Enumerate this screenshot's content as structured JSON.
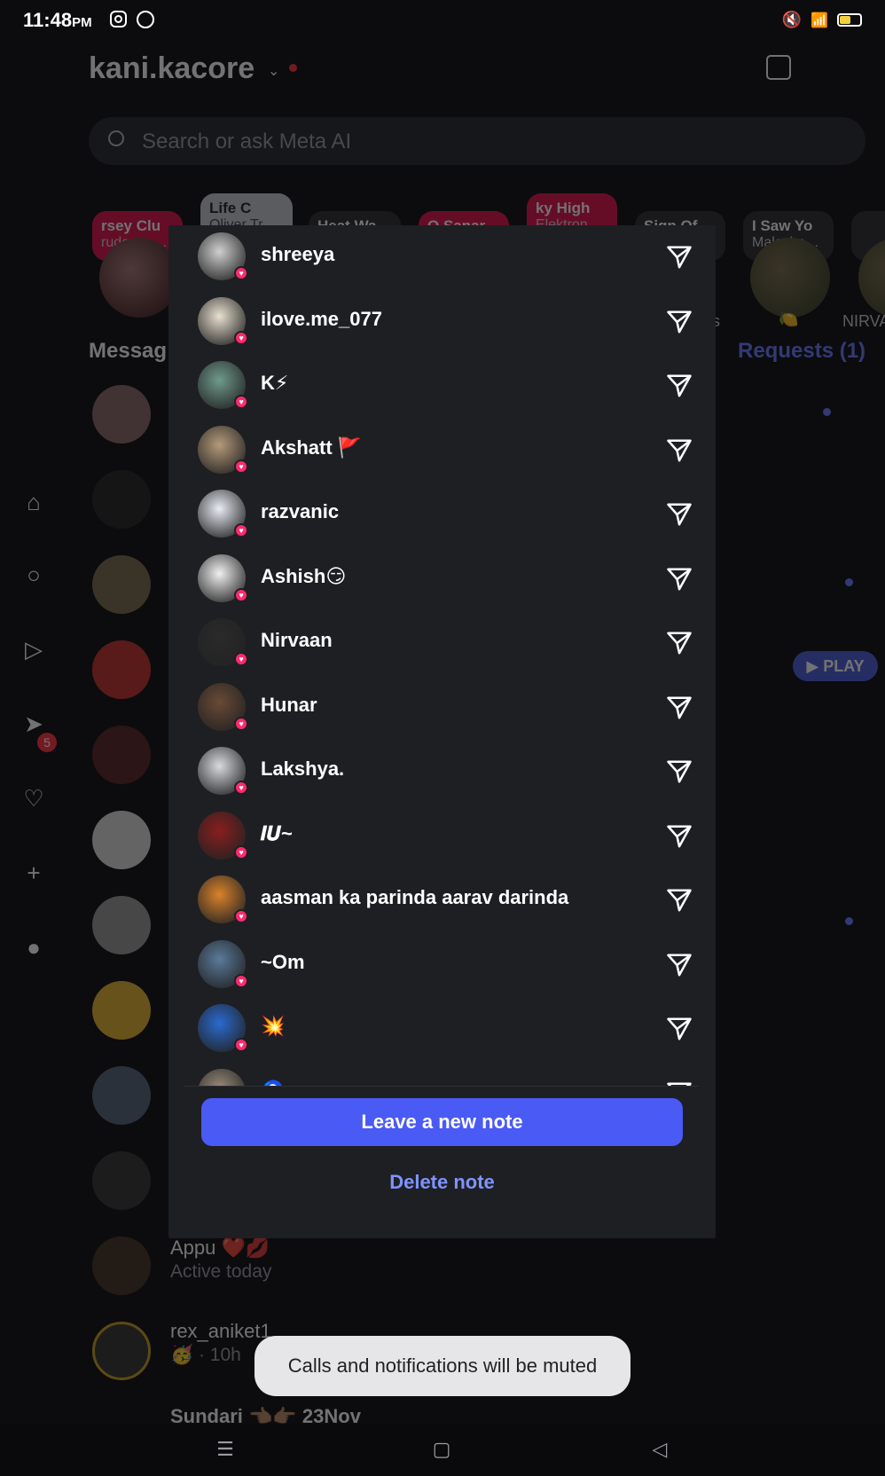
{
  "status_bar": {
    "time": "11:48",
    "ampm": "PM"
  },
  "header": {
    "username": "kani.kacore"
  },
  "search": {
    "placeholder": "Search or ask Meta AI"
  },
  "notes": [
    {
      "title": "rsey Clu",
      "subtitle": "rudo ma…"
    },
    {
      "title": "Life C",
      "subtitle": "Oliver Tr…"
    },
    {
      "title": "Heat Wa",
      "subtitle": ""
    },
    {
      "title": "O Sanar",
      "subtitle": ""
    },
    {
      "title": "ky High",
      "subtitle": "Elektron…"
    },
    {
      "title": "Sign Of",
      "subtitle": ""
    },
    {
      "title": "I Saw Yo",
      "subtitle": "Malcolm…"
    }
  ],
  "story_labels": {
    "label1": "ss",
    "label2": "🍋",
    "label3": "NIRVA"
  },
  "messages_header": "Messag",
  "requests_label": "Requests (1)",
  "sidenav_badge": "5",
  "play_label": "▶ PLAY",
  "background_rows": [
    {
      "name": "Appu ❤️💋",
      "sub": "Active today"
    },
    {
      "name": "rex_aniket1",
      "sub": "🥳 · 10h"
    },
    {
      "name": "Sundari 👈🏽👉🏽 23Nov",
      "sub": ""
    }
  ],
  "sheet": {
    "recipients": [
      {
        "name": "shreeya",
        "avatar_color": "#cfcfcf"
      },
      {
        "name": "ilove.me_077",
        "avatar_color": "#e8e0d0"
      },
      {
        "name": "K⚡",
        "avatar_color": "#6f9a8c"
      },
      {
        "name": "Akshatt 🚩",
        "avatar_color": "#b59a7a"
      },
      {
        "name": "razvanic",
        "avatar_color": "#e8ecf4"
      },
      {
        "name": "Ashish😏",
        "avatar_color": "#f0f0f0"
      },
      {
        "name": "Nirvaan",
        "avatar_color": "#2a2a2a"
      },
      {
        "name": "Hunar",
        "avatar_color": "#6a4a36"
      },
      {
        "name": "Lakshya.",
        "avatar_color": "#d8dadf"
      },
      {
        "name": "𝑰𝑼~",
        "avatar_color": "#8a1e1e"
      },
      {
        "name": "aasman ka parinda aarav darinda",
        "avatar_color": "#d9822b"
      },
      {
        "name": "~Om",
        "avatar_color": "#5a7a9a"
      },
      {
        "name": "💥",
        "avatar_color": "#2a6ad0"
      },
      {
        "name": "🧿",
        "avatar_color": "#9a8a7a"
      }
    ],
    "primary_button": "Leave a new note",
    "secondary_button": "Delete note"
  },
  "toast": "Calls and notifications will be muted"
}
